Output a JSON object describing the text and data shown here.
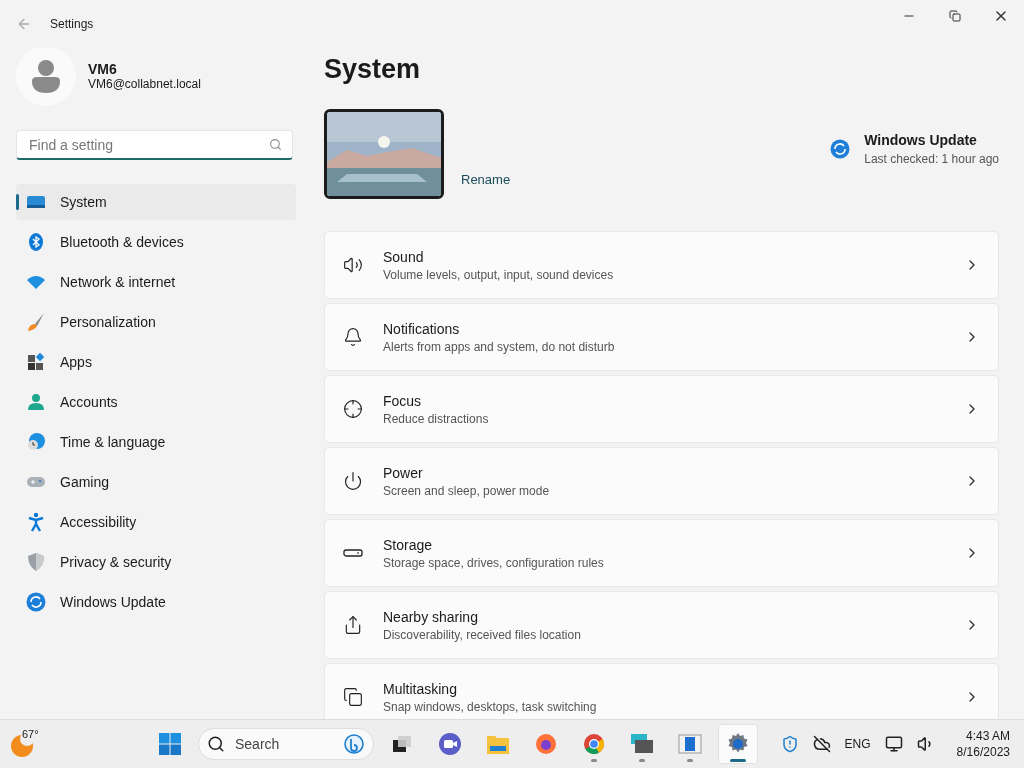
{
  "window": {
    "title": "Settings"
  },
  "user": {
    "name": "VM6",
    "email": "VM6@collabnet.local"
  },
  "search": {
    "placeholder": "Find a setting"
  },
  "sidebar": {
    "items": [
      {
        "label": "System",
        "selected": true
      },
      {
        "label": "Bluetooth & devices",
        "selected": false
      },
      {
        "label": "Network & internet",
        "selected": false
      },
      {
        "label": "Personalization",
        "selected": false
      },
      {
        "label": "Apps",
        "selected": false
      },
      {
        "label": "Accounts",
        "selected": false
      },
      {
        "label": "Time & language",
        "selected": false
      },
      {
        "label": "Gaming",
        "selected": false
      },
      {
        "label": "Accessibility",
        "selected": false
      },
      {
        "label": "Privacy & security",
        "selected": false
      },
      {
        "label": "Windows Update",
        "selected": false
      }
    ]
  },
  "page": {
    "title": "System",
    "device": {
      "rename": "Rename"
    },
    "update": {
      "title": "Windows Update",
      "subtitle": "Last checked: 1 hour ago"
    },
    "cards": [
      {
        "title": "Sound",
        "description": "Volume levels, output, input, sound devices"
      },
      {
        "title": "Notifications",
        "description": "Alerts from apps and system, do not disturb"
      },
      {
        "title": "Focus",
        "description": "Reduce distractions"
      },
      {
        "title": "Power",
        "description": "Screen and sleep, power mode"
      },
      {
        "title": "Storage",
        "description": "Storage space, drives, configuration rules"
      },
      {
        "title": "Nearby sharing",
        "description": "Discoverability, received files location"
      },
      {
        "title": "Multitasking",
        "description": "Snap windows, desktops, task switching"
      }
    ]
  },
  "taskbar": {
    "weather": "67°",
    "search": "Search",
    "apps": [
      {
        "running": false,
        "selected": false
      },
      {
        "running": false,
        "selected": false
      },
      {
        "running": false,
        "selected": false
      },
      {
        "running": false,
        "selected": false
      },
      {
        "running": false,
        "selected": false
      },
      {
        "running": true,
        "selected": false
      },
      {
        "running": true,
        "selected": false
      },
      {
        "running": true,
        "selected": false
      },
      {
        "running": true,
        "selected": true
      }
    ],
    "language": "ENG",
    "time": "4:43 AM",
    "date": "8/16/2023"
  }
}
